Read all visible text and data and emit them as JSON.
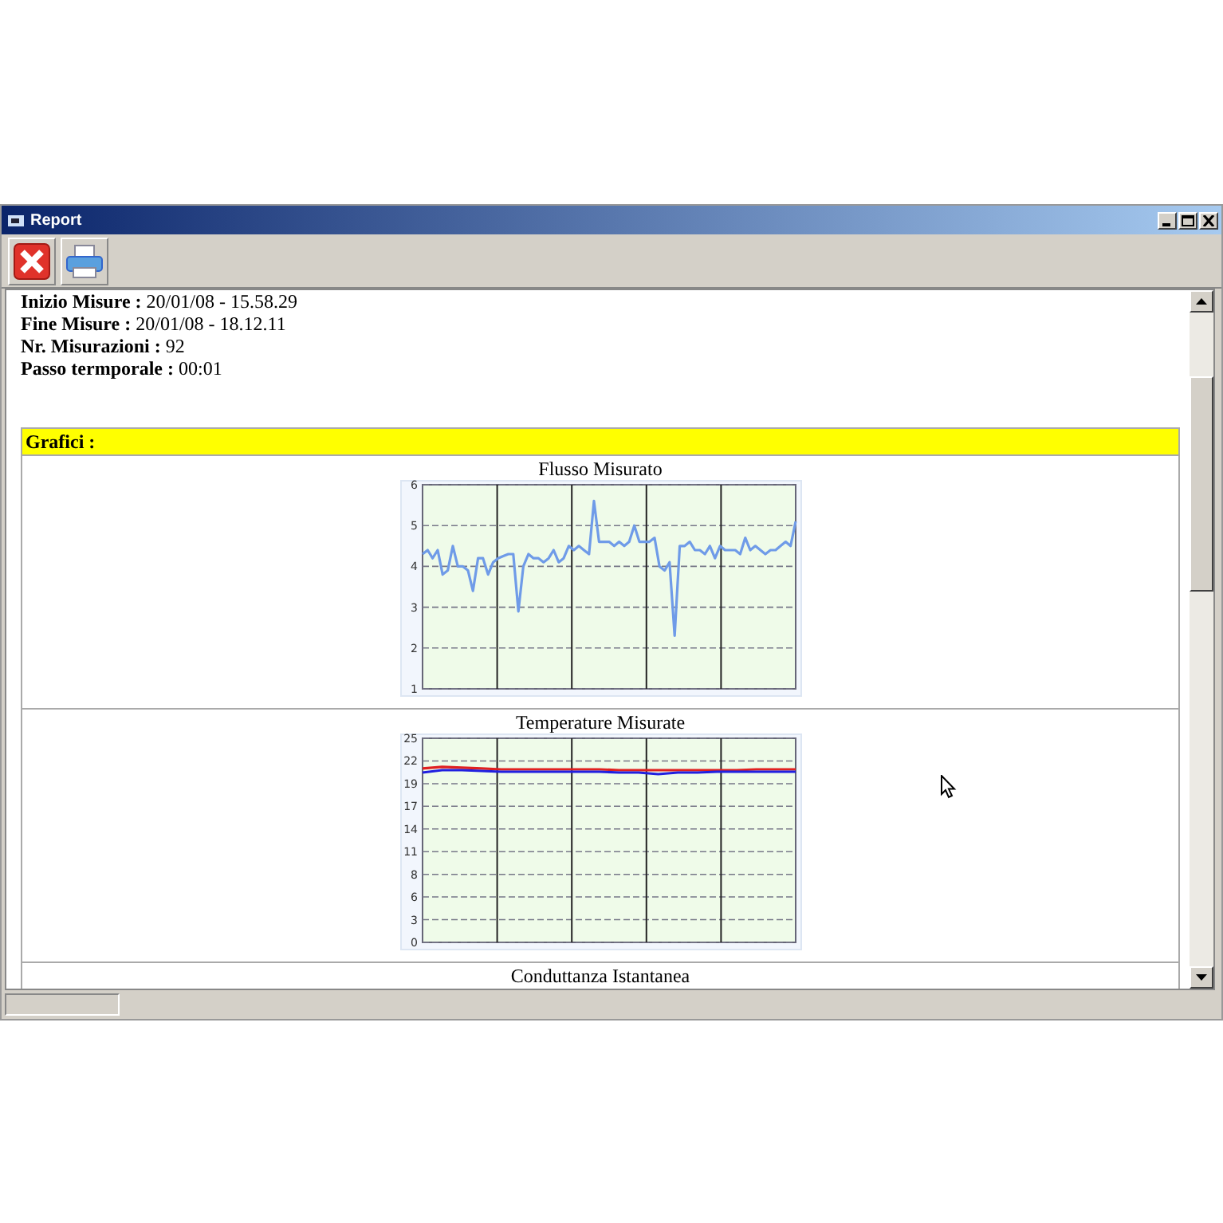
{
  "window": {
    "title": "Report"
  },
  "toolbar": {
    "buttons": [
      {
        "kind": "close"
      },
      {
        "kind": "print"
      }
    ]
  },
  "info": [
    "**Inizio Misure :** 20/01/08 - 15.58.29",
    "**Fine Misure :** 20/01/08 - 18.12.11",
    "**Nr. Misurazioni :** 92",
    "**Passo termporale :** 00:01"
  ],
  "section": {
    "title": "Grafici :"
  },
  "charts": [
    {
      "title": "Flusso Misurato",
      "chart_data": {
        "type": "line",
        "grid": true,
        "ylim": [
          1,
          6
        ],
        "yticks": [
          1,
          2,
          3,
          4,
          5,
          6
        ],
        "series": [
          {
            "color": "#6f9be8",
            "values": [
              4.3,
              4.4,
              4.2,
              4.4,
              3.8,
              3.9,
              4.5,
              4.0,
              4.0,
              3.9,
              3.4,
              4.2,
              4.2,
              3.8,
              4.1,
              4.2,
              4.25,
              4.3,
              4.3,
              2.9,
              4.0,
              4.3,
              4.2,
              4.2,
              4.1,
              4.2,
              4.4,
              4.1,
              4.2,
              4.5,
              4.4,
              4.5,
              4.4,
              4.3,
              5.6,
              4.6,
              4.6,
              4.6,
              4.5,
              4.6,
              4.5,
              4.6,
              5.0,
              4.6,
              4.6,
              4.6,
              4.7,
              4.0,
              3.9,
              4.1,
              2.3,
              4.5,
              4.5,
              4.6,
              4.4,
              4.4,
              4.3,
              4.5,
              4.2,
              4.5,
              4.4,
              4.4,
              4.4,
              4.3,
              4.7,
              4.4,
              4.5,
              4.4,
              4.3,
              4.4,
              4.4,
              4.5,
              4.6,
              4.5,
              5.1
            ]
          }
        ]
      }
    },
    {
      "title": "Temperature Misurate",
      "chart_data": {
        "type": "line",
        "grid": true,
        "ylim": [
          0,
          25
        ],
        "yticks": [
          {
            "value": 0,
            "label": "0"
          },
          {
            "value": 2.78,
            "label": "3"
          },
          {
            "value": 5.56,
            "label": "6"
          },
          {
            "value": 8.33,
            "label": "8"
          },
          {
            "value": 11.11,
            "label": "11"
          },
          {
            "value": 13.89,
            "label": "14"
          },
          {
            "value": 16.67,
            "label": "17"
          },
          {
            "value": 19.44,
            "label": "19"
          },
          {
            "value": 22.22,
            "label": "22"
          },
          {
            "value": 25,
            "label": "25"
          }
        ],
        "series": [
          {
            "color": "#e02020",
            "values": [
              21.3,
              21.5,
              21.4,
              21.3,
              21.2,
              21.2,
              21.2,
              21.2,
              21.2,
              21.2,
              21.1,
              21.1,
              21.1,
              21.1,
              21.1,
              21.1,
              21.1,
              21.2,
              21.2,
              21.2
            ]
          },
          {
            "color": "#2020e0",
            "values": [
              20.8,
              21.1,
              21.1,
              21.0,
              20.9,
              20.9,
              20.9,
              20.9,
              20.9,
              20.9,
              20.8,
              20.8,
              20.6,
              20.8,
              20.8,
              20.9,
              20.9,
              20.9,
              20.9,
              20.9
            ]
          }
        ]
      }
    },
    {
      "title": "Conduttanza Istantanea"
    }
  ]
}
